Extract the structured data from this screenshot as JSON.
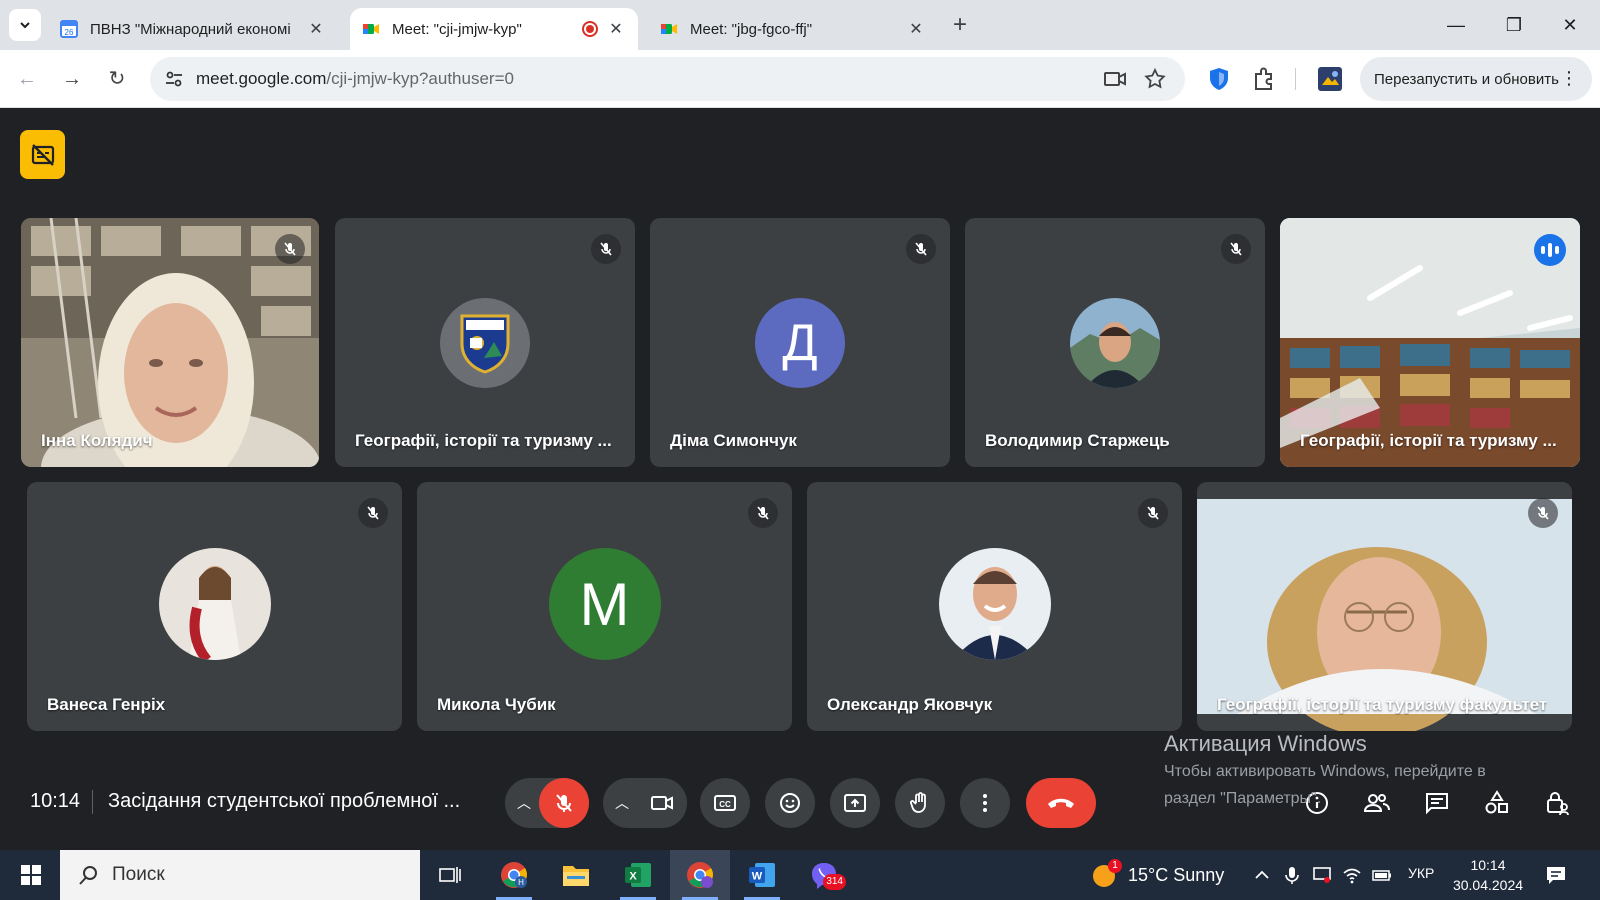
{
  "browser": {
    "tabs": [
      {
        "title": "ПВНЗ \"Міжнародний економі",
        "favicon": "calendar-icon",
        "active": false
      },
      {
        "title": "Meet: \"cji-jmjw-kyp\"",
        "favicon": "google-meet-icon",
        "active": true,
        "recording": true
      },
      {
        "title": "Meet: \"jbg-fgco-ffj\"",
        "favicon": "google-meet-icon",
        "active": false
      }
    ],
    "url_host": "meet.google.com",
    "url_path": "/cji-jmjw-kyp?authuser=0",
    "relaunch_label": "Перезапустить и обновить"
  },
  "meet": {
    "participants_row1": [
      {
        "name": "Інна Колядич",
        "kind": "video",
        "muted": true
      },
      {
        "name": "Географії, історії та туризму ...",
        "kind": "logo-avatar",
        "muted": true
      },
      {
        "name": "Діма Симончук",
        "kind": "letter-avatar",
        "letter": "Д",
        "avatar_color": "#5c6bc0",
        "muted": true
      },
      {
        "name": "Володимир Старжець",
        "kind": "photo-avatar",
        "muted": true
      },
      {
        "name": "Географії, історії та туризму ...",
        "kind": "video",
        "speaking": true
      }
    ],
    "participants_row2": [
      {
        "name": "Ванеса Генріх",
        "kind": "photo-avatar",
        "muted": true
      },
      {
        "name": "Микола Чубик",
        "kind": "letter-avatar",
        "letter": "М",
        "avatar_color": "#2e7d32",
        "muted": true
      },
      {
        "name": "Олександр Яковчук",
        "kind": "photo-avatar",
        "muted": true
      },
      {
        "name": "Географії, історії та туризму факультет",
        "kind": "video",
        "muted": true
      }
    ],
    "time": "10:14",
    "meeting_title": "Засідання студентської проблемної ...",
    "accent_colors": {
      "end_call": "#ea4335",
      "speaking_outline": "#8ab4f8"
    }
  },
  "activation": {
    "title": "Активация Windows",
    "line1": "Чтобы активировать Windows, перейдите в",
    "line2": "раздел \"Параметры\"."
  },
  "taskbar": {
    "search_placeholder": "Поиск",
    "viber_badge": "314",
    "weather_badge": "1",
    "weather_text": "15°C  Sunny",
    "language": "УКР",
    "clock_time": "10:14",
    "clock_date": "30.04.2024"
  }
}
